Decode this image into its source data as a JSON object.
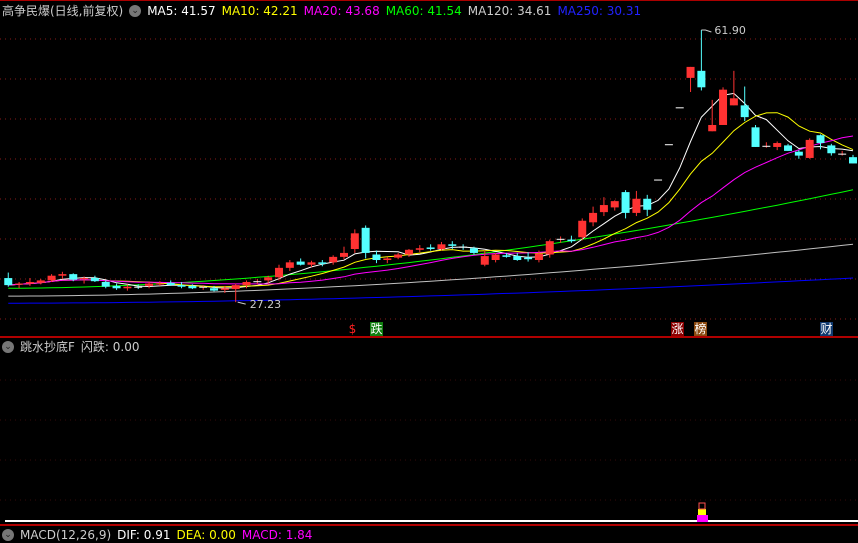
{
  "header": {
    "title": "高争民爆(日线,前复权)",
    "ma5": "MA5: 41.57",
    "ma10": "MA10: 42.21",
    "ma20": "MA20: 43.68",
    "ma60": "MA60: 41.54",
    "ma120": "MA120: 34.61",
    "ma250": "MA250: 30.31"
  },
  "colors": {
    "up": "#ff3232",
    "down": "#54ffff",
    "ma5": "#ffffff",
    "ma10": "#ffff00",
    "ma20": "#ff00ff",
    "ma60": "#00ff00",
    "ma120": "#c0c0c0",
    "ma250": "#0000ff"
  },
  "annotations": {
    "high": "61.90",
    "low": "27.23"
  },
  "markers": [
    {
      "text": "$",
      "bg": "transparent",
      "fg": "#ff2020"
    },
    {
      "text": "跌",
      "bg": "#108010",
      "fg": "#fff"
    },
    {
      "text": "涨",
      "bg": "#8b0000",
      "fg": "#fff"
    },
    {
      "text": "榜",
      "bg": "#8b4a10",
      "fg": "#fff"
    },
    {
      "text": "财",
      "bg": "#103a70",
      "fg": "#fff"
    }
  ],
  "indicator": {
    "title": "跳水抄底F",
    "value": "闪跌: 0.00"
  },
  "macd": {
    "title": "MACD(12,26,9)",
    "dif": "DIF: 0.91",
    "dea": "DEA: 0.00",
    "macd": "MACD: 1.84"
  },
  "chart_data": {
    "type": "candlestick",
    "ylim": [
      26.5,
      62.5
    ],
    "candles": [
      [
        30.3,
        31.0,
        29.2,
        29.4
      ],
      [
        29.5,
        29.8,
        29.0,
        29.6
      ],
      [
        29.6,
        30.3,
        29.3,
        29.8
      ],
      [
        29.7,
        30.2,
        29.5,
        30.0
      ],
      [
        30.0,
        30.8,
        29.8,
        30.6
      ],
      [
        30.6,
        31.1,
        30.2,
        30.8
      ],
      [
        30.8,
        30.9,
        29.9,
        30.1
      ],
      [
        30.2,
        30.5,
        29.6,
        30.3
      ],
      [
        30.3,
        30.6,
        29.8,
        29.9
      ],
      [
        29.8,
        30.0,
        29.0,
        29.2
      ],
      [
        29.3,
        29.6,
        28.8,
        29.0
      ],
      [
        29.0,
        29.5,
        28.7,
        29.2
      ],
      [
        29.2,
        29.5,
        28.9,
        29.1
      ],
      [
        29.3,
        29.8,
        29.0,
        29.6
      ],
      [
        29.5,
        29.9,
        29.3,
        29.6
      ],
      [
        29.7,
        30.0,
        29.3,
        29.4
      ],
      [
        29.4,
        29.8,
        29.0,
        29.2
      ],
      [
        29.3,
        29.5,
        28.9,
        29.0
      ],
      [
        29.1,
        29.4,
        28.8,
        29.2
      ],
      [
        29.0,
        29.3,
        28.6,
        28.7
      ],
      [
        28.8,
        29.3,
        28.4,
        29.0
      ],
      [
        28.9,
        29.6,
        27.23,
        29.4
      ],
      [
        29.4,
        30.0,
        29.0,
        29.8
      ],
      [
        29.8,
        30.2,
        29.5,
        29.9
      ],
      [
        30.0,
        30.6,
        29.6,
        30.4
      ],
      [
        30.4,
        32.0,
        30.0,
        31.6
      ],
      [
        31.6,
        32.6,
        31.2,
        32.3
      ],
      [
        32.4,
        32.8,
        31.9,
        32.0
      ],
      [
        32.0,
        32.5,
        31.7,
        32.3
      ],
      [
        32.3,
        32.6,
        31.8,
        32.1
      ],
      [
        32.3,
        33.2,
        32.0,
        33.0
      ],
      [
        33.0,
        34.3,
        32.7,
        33.5
      ],
      [
        34.0,
        36.5,
        33.5,
        36.0
      ],
      [
        36.7,
        37.0,
        32.8,
        33.5
      ],
      [
        33.3,
        33.8,
        32.2,
        32.6
      ],
      [
        32.6,
        33.0,
        32.2,
        32.8
      ],
      [
        32.9,
        33.5,
        32.7,
        33.3
      ],
      [
        33.3,
        34.0,
        33.0,
        33.9
      ],
      [
        33.9,
        34.5,
        33.6,
        34.1
      ],
      [
        34.2,
        34.6,
        33.8,
        34.0
      ],
      [
        34.0,
        34.9,
        33.8,
        34.6
      ],
      [
        34.6,
        35.0,
        34.0,
        34.4
      ],
      [
        34.3,
        34.6,
        33.9,
        34.2
      ],
      [
        34.1,
        34.3,
        33.3,
        33.5
      ],
      [
        32.0,
        33.8,
        31.8,
        33.1
      ],
      [
        32.6,
        33.5,
        32.3,
        33.3
      ],
      [
        33.2,
        33.5,
        32.9,
        33.0
      ],
      [
        33.1,
        33.5,
        32.5,
        32.6
      ],
      [
        32.9,
        33.6,
        32.4,
        32.7
      ],
      [
        32.6,
        33.8,
        32.3,
        33.4
      ],
      [
        33.3,
        35.2,
        32.9,
        35.0
      ],
      [
        35.2,
        35.6,
        34.8,
        35.3
      ],
      [
        35.2,
        35.7,
        34.8,
        35.0
      ],
      [
        35.5,
        37.9,
        35.1,
        37.6
      ],
      [
        37.4,
        39.4,
        36.9,
        38.6
      ],
      [
        38.7,
        40.6,
        38.2,
        39.6
      ],
      [
        39.3,
        40.2,
        38.9,
        40.1
      ],
      [
        41.25,
        41.5,
        37.9,
        38.6
      ],
      [
        38.6,
        41.4,
        38.2,
        40.4
      ],
      [
        40.4,
        40.9,
        38.2,
        39.0
      ],
      [
        42.8,
        42.8,
        42.8,
        42.85
      ],
      [
        47.3,
        47.3,
        47.3,
        47.35
      ],
      [
        52.0,
        52.0,
        52.0,
        52.05
      ],
      [
        55.8,
        57.2,
        54.0,
        57.2
      ],
      [
        56.7,
        61.9,
        54.2,
        54.6
      ],
      [
        49.0,
        53.0,
        49.0,
        49.8
      ],
      [
        49.8,
        54.6,
        49.8,
        54.3
      ],
      [
        52.3,
        56.7,
        52.3,
        53.2
      ],
      [
        52.3,
        54.7,
        50.3,
        50.8
      ],
      [
        49.5,
        49.8,
        47.0,
        47.0
      ],
      [
        47.1,
        47.6,
        46.9,
        47.15
      ],
      [
        47.0,
        47.7,
        46.6,
        47.5
      ],
      [
        47.2,
        47.4,
        46.5,
        46.5
      ],
      [
        46.4,
        46.6,
        45.5,
        45.9
      ],
      [
        45.6,
        48.1,
        45.5,
        47.9
      ],
      [
        48.5,
        48.6,
        46.7,
        47.5
      ],
      [
        47.2,
        47.4,
        45.9,
        46.2
      ],
      [
        46.1,
        46.5,
        45.9,
        46.15
      ],
      [
        45.7,
        46.0,
        44.9,
        44.9
      ]
    ],
    "ma60": [
      29.0,
      41.54
    ],
    "ma120": [
      28.0,
      34.61
    ],
    "ma250": [
      27.1,
      30.31
    ]
  }
}
